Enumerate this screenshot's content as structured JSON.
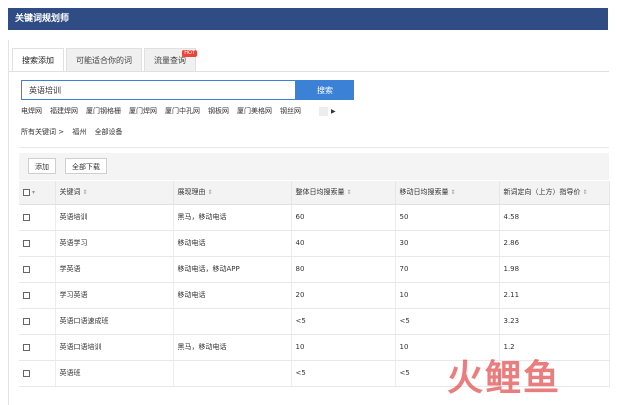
{
  "window": {
    "title": "关键词规划师"
  },
  "tabs": [
    {
      "label": "搜索添加",
      "active": true
    },
    {
      "label": "可能适合你的词",
      "active": false
    },
    {
      "label": "流量查询",
      "active": false,
      "badge": "HOT"
    }
  ],
  "search": {
    "value": "英语培训",
    "button_label": "搜索"
  },
  "related_keywords": [
    "电焊网",
    "福建焊网",
    "厦门钢格栅",
    "厦门焊网",
    "厦门中孔网",
    "钢板网",
    "厦门美格网",
    "钢丝网"
  ],
  "breadcrumb": [
    "所有关键词 >",
    "福州",
    "全部设备"
  ],
  "toolbar": {
    "add_label": "添加",
    "download_label": "全部下载"
  },
  "table": {
    "headers": [
      "关键词",
      "展现理由",
      "整体日均搜索量",
      "移动日均搜索量",
      "新词定向（上方）指导价"
    ],
    "sort_glyph": "⇕",
    "rows": [
      [
        "英语培训",
        "黑马，移动电话",
        "60",
        "50",
        "4.58"
      ],
      [
        "英语学习",
        "移动电话",
        "40",
        "30",
        "2.86"
      ],
      [
        "学英语",
        "移动电话，移动APP",
        "80",
        "70",
        "1.98"
      ],
      [
        "学习英语",
        "移动电话",
        "20",
        "10",
        "2.11"
      ],
      [
        "英语口语速成班",
        "",
        "<5",
        "<5",
        "3.23"
      ],
      [
        "英语口语培训",
        "黑马，移动电话",
        "10",
        "10",
        "1.2"
      ],
      [
        "英语班",
        "",
        "<5",
        "<5",
        ""
      ]
    ]
  },
  "watermark": {
    "text": "火鲤鱼"
  },
  "colors": {
    "header_bar": "#2f4d84",
    "accent": "#3b82d6",
    "watermark": "#dc2828"
  }
}
